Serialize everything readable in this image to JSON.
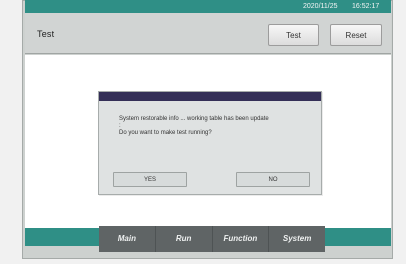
{
  "status_bar": {
    "date": "2020/11/25",
    "time": "16:52:17"
  },
  "header": {
    "title": "Test",
    "buttons": [
      {
        "label": "Test"
      },
      {
        "label": "Reset"
      }
    ]
  },
  "dialog": {
    "message_line_1": "System restorable info ... working table has been update",
    "message_line_2": "Do you want to make test running?",
    "buttons": [
      {
        "label": "YES"
      },
      {
        "label": "NO"
      }
    ]
  },
  "bottom_nav": {
    "tabs": [
      {
        "label": "Main"
      },
      {
        "label": "Run"
      },
      {
        "label": "Function"
      },
      {
        "label": "System"
      }
    ]
  },
  "colors": {
    "accent": "#2f8f86",
    "dialog_titlebar": "#342f57",
    "nav_background": "#5f6465"
  }
}
